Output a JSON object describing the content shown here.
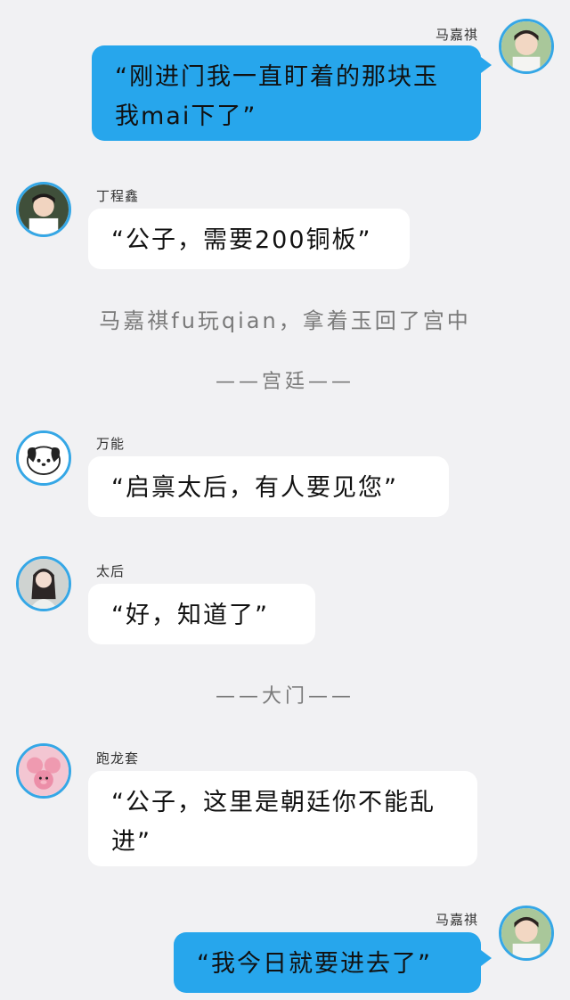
{
  "messages": [
    {
      "sender": "马嘉祺",
      "text": "“刚进门我一直盯着的那块玉我mai下了”",
      "side": "right",
      "avatar": "avatar-boy-photo"
    },
    {
      "sender": "丁程鑫",
      "text": "“公子，需要200铜板”",
      "side": "left",
      "avatar": "avatar-boy-photo-2"
    },
    {
      "sender": "万能",
      "text": "“启禀太后，有人要见您”",
      "side": "left",
      "avatar": "pochacco-dog-avatar"
    },
    {
      "sender": "太后",
      "text": "“好，知道了”",
      "side": "left",
      "avatar": "avatar-woman-photo"
    },
    {
      "sender": "跑龙套",
      "text": "“公子，这里是朝廷你不能乱进”",
      "side": "left",
      "avatar": "avatar-pink-pigs"
    },
    {
      "sender": "马嘉祺",
      "text": "“我今日就要进去了”",
      "side": "right",
      "avatar": "avatar-boy-photo"
    }
  ],
  "narration": "马嘉祺fu玩qian，拿着玉回了宫中",
  "dividers": [
    "——宫廷——",
    "——大门——"
  ],
  "colors": {
    "self_bubble": "#27a6ec",
    "other_bubble": "#ffffff",
    "background": "#f1f1f3",
    "avatar_ring": "#35a7e6"
  }
}
